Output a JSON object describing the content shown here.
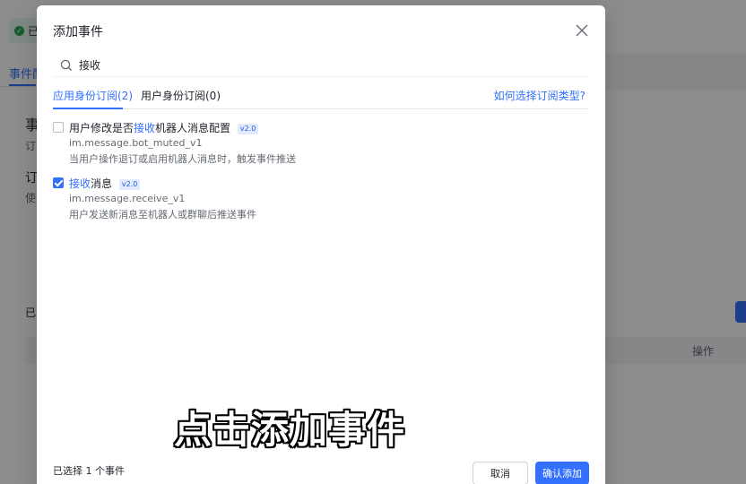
{
  "background": {
    "status_text": "已",
    "tab_label": "事件配",
    "heading": "事",
    "sub": "订",
    "heading2": "订",
    "sub2": "使",
    "selected_label": "已",
    "col_ops": "操作"
  },
  "modal": {
    "title": "添加事件",
    "search": {
      "value": "接收",
      "placeholder": ""
    },
    "tabs": [
      {
        "label": "应用身份订阅(2)",
        "active": true
      },
      {
        "label": "用户身份订阅(0)",
        "active": false
      }
    ],
    "help_link": "如何选择订阅类型?",
    "events": [
      {
        "title_before": "用户修改是否",
        "title_highlight": "接收",
        "title_after": "机器人消息配置",
        "badge": "v2.0",
        "code": "im.message.bot_muted_v1",
        "desc": "当用户操作退订或启用机器人消息时，触发事件推送",
        "checked": false
      },
      {
        "title_before": "",
        "title_highlight": "接收",
        "title_after": "消息",
        "badge": "v2.0",
        "code": "im.message.receive_v1",
        "desc": "用户发送新消息至机器人或群聊后推送事件",
        "checked": true
      }
    ],
    "footer": {
      "selected_count": "已选择 1 个事件",
      "cancel_label": "取消",
      "confirm_label": "确认添加"
    }
  },
  "caption": "点击添加事件",
  "colors": {
    "accent": "#3370ff",
    "overlay": "rgba(0,0,0,0.45)"
  },
  "icons": [
    "search-icon",
    "close-icon",
    "check-icon"
  ]
}
